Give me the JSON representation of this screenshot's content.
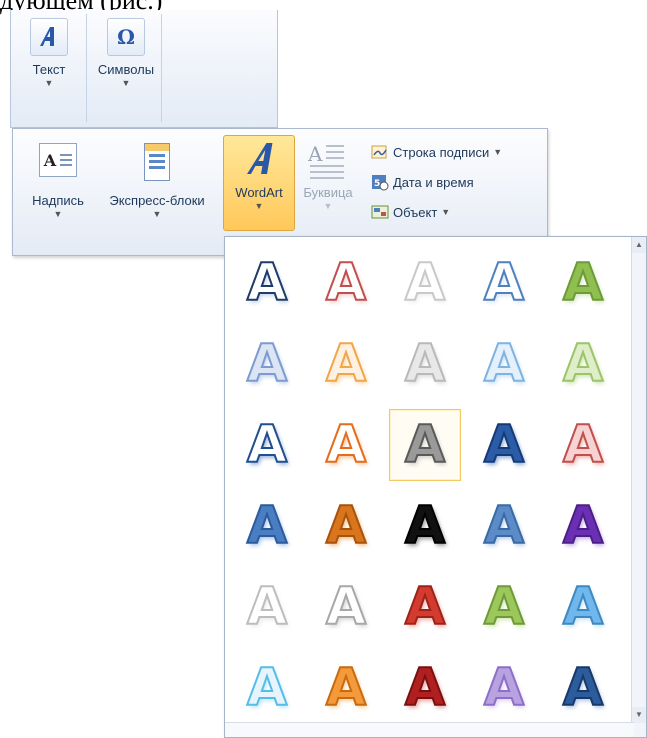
{
  "cut_text": "дующем (рис.)",
  "ribbon_top": {
    "buttons": [
      {
        "label": "Текст"
      },
      {
        "label": "Символы"
      }
    ]
  },
  "ribbon_main": {
    "buttons": [
      {
        "label": "Надпись"
      },
      {
        "label": "Экспресс-блоки"
      },
      {
        "label": "WordArt"
      },
      {
        "label": "Буквица"
      }
    ],
    "small_commands": [
      {
        "label": "Строка подписи",
        "has_dropdown": true
      },
      {
        "label": "Дата и время",
        "has_dropdown": false
      },
      {
        "label": "Объект",
        "has_dropdown": true
      }
    ]
  },
  "gallery": {
    "glyph": "A",
    "selected_index": 12,
    "styles": [
      {
        "fill": "#ffffff",
        "stroke": "#1f3b6a",
        "shadow": "#c8d6ee"
      },
      {
        "fill": "#ffffff",
        "stroke": "#c0504d",
        "shadow": "#f3d2d1"
      },
      {
        "fill": "#ffffff",
        "stroke": "#c9c9c9",
        "shadow": "#f0f0f0"
      },
      {
        "fill": "#ffffff",
        "stroke": "#4f81bd",
        "shadow": "#dbe6f4"
      },
      {
        "fill": "#8fbf4f",
        "stroke": "#6f9a3a",
        "shadow": "#d7e8c2"
      },
      {
        "fill": "#dbe5f3",
        "stroke": "#7d9bd2",
        "shadow": "#c5d5ee"
      },
      {
        "fill": "#fff1e2",
        "stroke": "#f0a64a",
        "shadow": "#ffd9a8"
      },
      {
        "fill": "#e8e8e8",
        "stroke": "#b9b9b9",
        "shadow": "#dddddd"
      },
      {
        "fill": "#e4f0fb",
        "stroke": "#7fb3e0",
        "shadow": "#cbe3f7"
      },
      {
        "fill": "#dfeec9",
        "stroke": "#9cc46b",
        "shadow": "#d0e6b0"
      },
      {
        "fill": "#ffffff",
        "stroke": "#1f4f8f",
        "shadow": "#9db5d8"
      },
      {
        "fill": "#ffffff",
        "stroke": "#e46c1b",
        "shadow": "#f8c9a0"
      },
      {
        "fill": "#9a9a9a",
        "stroke": "#5a5a5a",
        "shadow": "#d0d0d0"
      },
      {
        "fill": "#2b5ca8",
        "stroke": "#163a75",
        "shadow": "#90acd6"
      },
      {
        "fill": "#f6d2d2",
        "stroke": "#c0504d",
        "shadow": "#efb3b2"
      },
      {
        "fill": "#4a7ec2",
        "stroke": "#2d5a9b",
        "shadow": "#a9c7ee"
      },
      {
        "fill": "#d9751c",
        "stroke": "#a8530c",
        "shadow": "#f1c08e"
      },
      {
        "fill": "#111111",
        "stroke": "#000000",
        "shadow": "#9a9a9a"
      },
      {
        "fill": "#5b8cc8",
        "stroke": "#3a6aa6",
        "shadow": "#b9cfe9"
      },
      {
        "fill": "#6a2fb5",
        "stroke": "#4b1f86",
        "shadow": "#c7b0e6"
      },
      {
        "fill": "#ffffff",
        "stroke": "#bdbdbd",
        "shadow": "#ececec"
      },
      {
        "fill": "#ffffff",
        "stroke": "#a8a8a8",
        "shadow": "#d9d9d9"
      },
      {
        "fill": "#d33b30",
        "stroke": "#9e2218",
        "shadow": "#f1b1ab"
      },
      {
        "fill": "#9cc75a",
        "stroke": "#6f9a3a",
        "shadow": "#d3e8b5"
      },
      {
        "fill": "#6fb7ec",
        "stroke": "#3f89c3",
        "shadow": "#cbe5f8"
      },
      {
        "fill": "#e6f5fd",
        "stroke": "#58bde6",
        "shadow": "#c3e7f6"
      },
      {
        "fill": "#f49a3a",
        "stroke": "#c86a12",
        "shadow": "#fbd1a2"
      },
      {
        "fill": "#b02020",
        "stroke": "#7a1010",
        "shadow": "#e6a4a4"
      },
      {
        "fill": "#b8a3e0",
        "stroke": "#8b6fc8",
        "shadow": "#e0d5f3"
      },
      {
        "fill": "#2c5c9c",
        "stroke": "#17396b",
        "shadow": "#b4c7e2"
      }
    ]
  },
  "colors": {
    "ribbon_text": "#1e395b",
    "hover_fill": "#ffc85a",
    "selection_border": "#f2ca60"
  },
  "icons": [
    "wordart-icon",
    "omega-icon",
    "textbox-icon",
    "quickparts-icon",
    "dropcap-icon",
    "signature-icon",
    "datetime-icon",
    "object-icon"
  ]
}
